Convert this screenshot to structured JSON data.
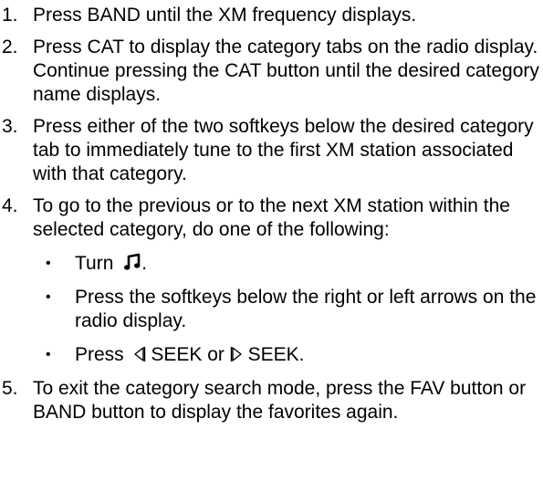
{
  "steps": [
    {
      "number": "1.",
      "text": "Press BAND until the XM frequency displays."
    },
    {
      "number": "2.",
      "text": "Press CAT to display the category tabs on the radio display. Continue pressing the CAT button until the desired category name displays."
    },
    {
      "number": "3.",
      "text": "Press either of the two softkeys below the desired category tab to immediately tune to the first XM station associated with that category."
    },
    {
      "number": "4.",
      "text": "To go to the previous or to the next XM station within the selected category, do one of the following:",
      "bullets": [
        {
          "text_before": "Turn",
          "icon": "music-note-knob-icon",
          "text_after": "."
        },
        {
          "text": "Press the softkeys below the right or left arrows on the radio display."
        },
        {
          "text_before": "Press",
          "icon_left": "seek-back-icon",
          "label_left": "SEEK or",
          "icon_right": "seek-forward-icon",
          "label_right": "SEEK."
        }
      ]
    },
    {
      "number": "5.",
      "text": "To exit the category search mode, press the FAV button or BAND button to display the favorites again."
    }
  ],
  "bullet_symbol": "•",
  "colors": {
    "text": "#000000",
    "background": "#ffffff"
  }
}
